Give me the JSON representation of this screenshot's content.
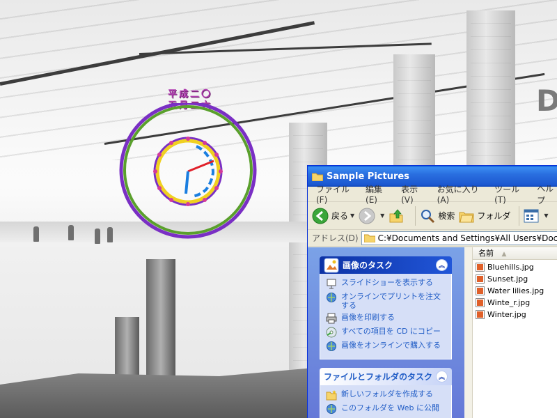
{
  "clock": {
    "date_line1": "平成二〇",
    "date_line2": "五月二六"
  },
  "window": {
    "title": "Sample Pictures",
    "menu": [
      "ファイル(F)",
      "編集(E)",
      "表示(V)",
      "お気に入り(A)",
      "ツール(T)",
      "ヘルプ"
    ],
    "toolbar": {
      "back_label": "戻る",
      "search_label": "検索",
      "folders_label": "フォルダ"
    },
    "address": {
      "label": "アドレス(D)",
      "value": "C:¥Documents and Settings¥All Users¥Documents¥M"
    },
    "image_tasks": {
      "title": "画像のタスク",
      "items": [
        "スライドショーを表示する",
        "オンラインでプリントを注文する",
        "画像を印刷する",
        "すべての項目を CD にコピー",
        "画像をオンラインで購入する"
      ]
    },
    "file_tasks": {
      "title": "ファイルとフォルダのタスク",
      "items": [
        "新しいフォルダを作成する",
        "このフォルダを Web に公開"
      ]
    },
    "file_list": {
      "column_name": "名前",
      "files": [
        "Bluehills.jpg",
        "Sunset.jpg",
        "Water lilies.jpg",
        "Winte_r.jpg",
        "Winter.jpg"
      ]
    }
  },
  "colors": {
    "titlebar": "#2a6fe0",
    "taskpane": "#7ba2e7",
    "link": "#215dc6",
    "clock_outer_green": "#5aa02c",
    "clock_outer_purple": "#7a2fc4",
    "clock_hand_red": "#e0202a",
    "clock_hand_blue": "#1a7ee0"
  }
}
